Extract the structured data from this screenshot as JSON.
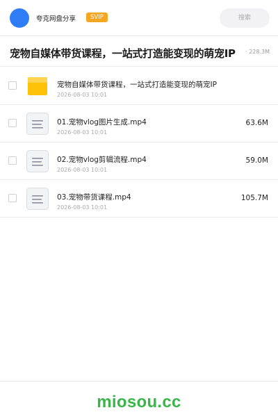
{
  "header": {
    "app_title": "夸克网盘分享",
    "badge": "SVIP",
    "search_placeholder": "搜索"
  },
  "folder": {
    "title": "宠物自媒体带货课程，一站式打造能变现的萌宠IP",
    "meta": "· 228.3M"
  },
  "files": [
    {
      "name": "宠物自媒体带货课程，一站式打造能变现的萌宠IP",
      "date": "2026-08-03 10:01",
      "size": "",
      "icon": "folder-icon"
    },
    {
      "name": "01.宠物vlog图片生成.mp4",
      "date": "2026-08-03 10:01",
      "size": "63.6M",
      "icon": "video-file-icon"
    },
    {
      "name": "02.宠物vlog剪辑流程.mp4",
      "date": "2026-08-03 10:01",
      "size": "59.0M",
      "icon": "video-file-icon"
    },
    {
      "name": "03.宠物带货课程.mp4",
      "date": "2026-08-03 10:01",
      "size": "105.7M",
      "icon": "video-file-icon"
    }
  ],
  "footer": {
    "watermark": "miosou.cc"
  },
  "colors": {
    "avatar": "#2f7df6",
    "badge": "#f5a623",
    "folder": "#ffc107",
    "watermark": "#3ab54a"
  }
}
